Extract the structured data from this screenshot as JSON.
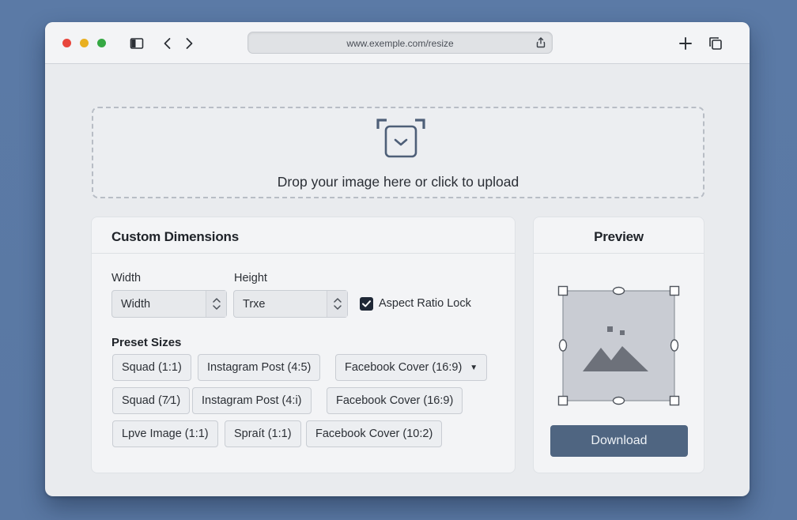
{
  "browser": {
    "url": "www.exemple.com/resize"
  },
  "upload": {
    "prompt": "Drop your image here or click to upload"
  },
  "custom_dimensions": {
    "title": "Custom Dimensions",
    "width_label": "Width",
    "width_value": "Width",
    "height_label": "Height",
    "height_value": "Trxe",
    "aspect_lock_label": "Aspect Ratio Lock",
    "aspect_lock_checked": true,
    "presets_label": "Preset Sizes",
    "presets": [
      {
        "label": "Squad (1:1)"
      },
      {
        "label": "Instagram Post (4:5)"
      },
      {
        "label": "Facebook Cover (16:9)"
      },
      {
        "label": "Squad (7⁄1)"
      },
      {
        "label": "Instagram Post (4:i)"
      },
      {
        "label": "Facebook Cover (16:9)"
      },
      {
        "label": "Lpve Image (1:1)"
      },
      {
        "label": "Spraít (1:1)"
      },
      {
        "label": "Facebook Cover (10:2)"
      }
    ]
  },
  "preview": {
    "title": "Preview",
    "download_label": "Download"
  },
  "icons": {
    "sidebar": "sidebar-icon",
    "back": "chevron-left-icon",
    "forward": "chevron-right-icon",
    "share": "share-icon",
    "new_tab": "plus-icon",
    "tabs": "tabs-icon",
    "upload": "upload-frame-icon",
    "image_placeholder": "image-placeholder-icon"
  },
  "colors": {
    "accent_button": "#4f6581",
    "background": "#5b7aa6"
  }
}
